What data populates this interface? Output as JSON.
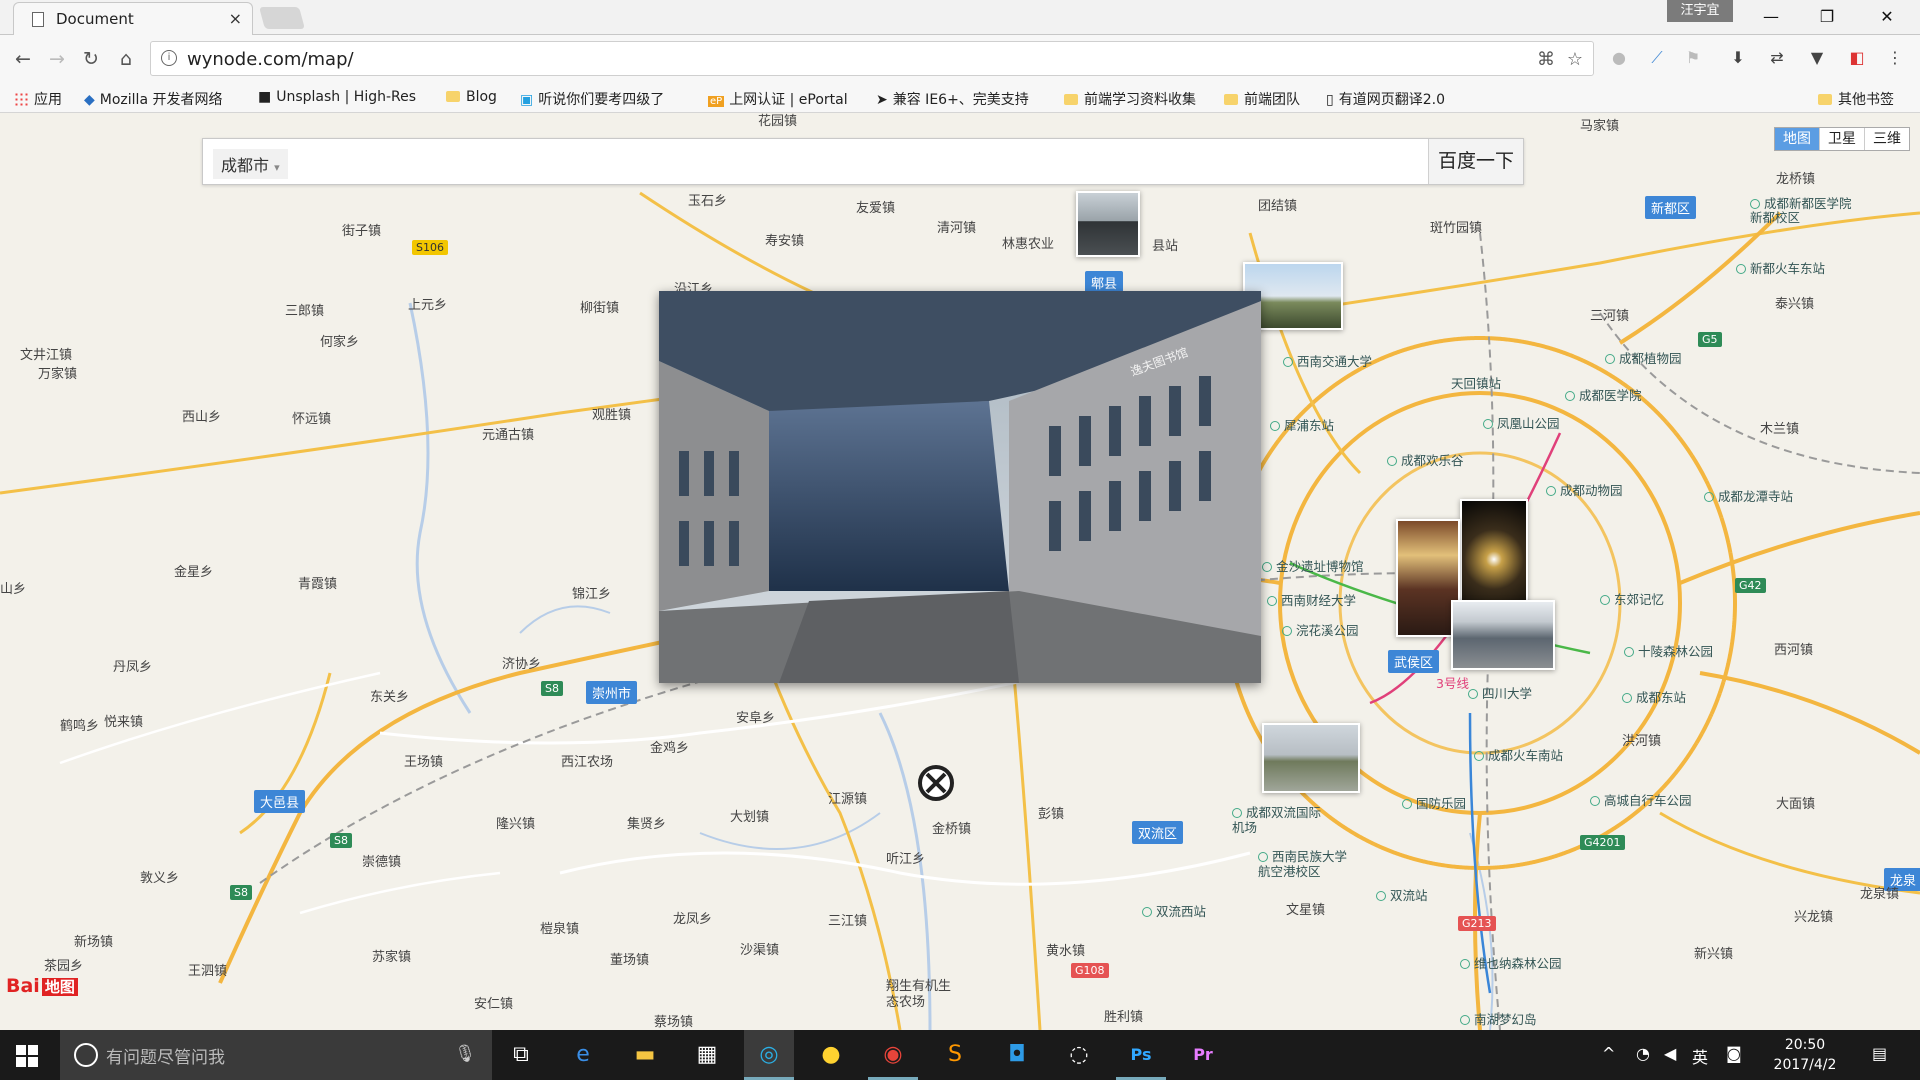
{
  "browser": {
    "tab_title": "Document",
    "tab_close": "×",
    "user_name": "汪宇宜",
    "window_controls": [
      "—",
      "❐",
      "✕"
    ],
    "url": "wynode.com/map/",
    "bookmarks": [
      {
        "label": "应用",
        "icon": "apps-icon"
      },
      {
        "label": "Mozilla 开发者网络",
        "icon": "mdn-icon"
      },
      {
        "label": "Unsplash | High-Res",
        "icon": "camera-icon"
      },
      {
        "label": "Blog",
        "icon": "folder-icon"
      },
      {
        "label": "听说你们要考四级了",
        "icon": "bilibili-icon"
      },
      {
        "label": "上网认证 | ePortal",
        "icon": "eportal-icon"
      },
      {
        "label": "兼容 IE6+、完美支持",
        "icon": "arrow-icon"
      },
      {
        "label": "前端学习资料收集",
        "icon": "folder-icon"
      },
      {
        "label": "前端团队",
        "icon": "folder-icon"
      },
      {
        "label": "有道网页翻译2.0",
        "icon": "page-icon"
      },
      {
        "label": "其他书签",
        "icon": "folder-icon"
      }
    ]
  },
  "map": {
    "search": {
      "city": "成都市",
      "city_caret": "▾",
      "button": "百度一下",
      "placeholder": ""
    },
    "map_types": [
      "地图",
      "卫星",
      "三维"
    ],
    "logo": "Bai",
    "logo_suffix": "地图",
    "districts": [
      {
        "label": "新都区"
      },
      {
        "label": "郫县"
      },
      {
        "label": "崇州市"
      },
      {
        "label": "大邑县"
      },
      {
        "label": "双流区"
      },
      {
        "label": "武侯区"
      },
      {
        "label": "龙泉"
      }
    ],
    "places": [
      "花园镇",
      "马家镇",
      "龙桥镇",
      "玉石乡",
      "友爱镇",
      "团结镇",
      "斑竹园镇",
      "街子镇",
      "清河镇",
      "寿安镇",
      "林惠农业",
      "县站",
      "沿江乡",
      "三郎镇",
      "上元乡",
      "柳街镇",
      "何家乡",
      "文井江镇",
      "万家镇",
      "西山乡",
      "怀远镇",
      "元通古镇",
      "观胜镇",
      "金星乡",
      "青霞镇",
      "锦江乡",
      "山乡",
      "丹凤乡",
      "济协乡",
      "东关乡",
      "悦来镇",
      "鹤鸣乡",
      "安阜乡",
      "金鸡乡",
      "王场镇",
      "西江农场",
      "隆兴镇",
      "集贤乡",
      "大划镇",
      "江源镇",
      "金桥镇",
      "彭镇",
      "崇德镇",
      "敦义乡",
      "听江乡",
      "新场镇",
      "三江镇",
      "龙凤乡",
      "榿泉镇",
      "茶园乡",
      "王泗镇",
      "苏家镇",
      "董场镇",
      "沙渠镇",
      "黄水镇",
      "安仁镇",
      "蔡场镇",
      "翔生有机生态农场",
      "胜利镇",
      "文星镇",
      "龙泉镇",
      "泰兴镇",
      "木兰镇",
      "西河镇",
      "洪河镇",
      "大面镇",
      "兴龙镇",
      "新兴镇",
      "三河镇",
      "天回镇站"
    ],
    "pois": [
      "成都植物园",
      "成都医学院",
      "西南交通大学",
      "犀浦东站",
      "成都欢乐谷",
      "成都动物园",
      "成都龙潭寺站",
      "东郊记忆",
      "十陵森林公园",
      "成都东站",
      "成都火车南站",
      "国防乐园",
      "高城自行车公园",
      "成都双流国际机场",
      "西南民族大学航空港校区",
      "双流站",
      "双流西站",
      "维也纳森林公园",
      "南湖梦幻岛",
      "西南财经大学",
      "浣花溪公园",
      "四川大学",
      "凤凰山公园",
      "成都新都医学院新都校区",
      "新都火车东站",
      "金沙遗址博物馆",
      "天回镇站"
    ],
    "shields": [
      "S106",
      "G5",
      "G42",
      "S8",
      "S8",
      "S8",
      "G108",
      "G213",
      "G4201"
    ],
    "metro": "3号线",
    "photos": [
      {
        "name": "thumb-pixian"
      },
      {
        "name": "thumb-swjtu"
      },
      {
        "name": "thumb-night-street"
      },
      {
        "name": "thumb-wuhou-temple"
      },
      {
        "name": "thumb-sichuan-uni"
      },
      {
        "name": "thumb-shuangliu"
      }
    ],
    "main_photo": {
      "sign": "逸夫图书馆"
    }
  },
  "taskbar": {
    "search_placeholder": "有问题尽管问我",
    "apps": [
      "task-view",
      "edge",
      "file-explorer",
      "store",
      "app-5",
      "app-6",
      "chrome",
      "sublime",
      "app-9",
      "app-10",
      "photoshop",
      "premiere"
    ],
    "tray_lang": "英",
    "time": "20:50",
    "date": "2017/4/2"
  }
}
